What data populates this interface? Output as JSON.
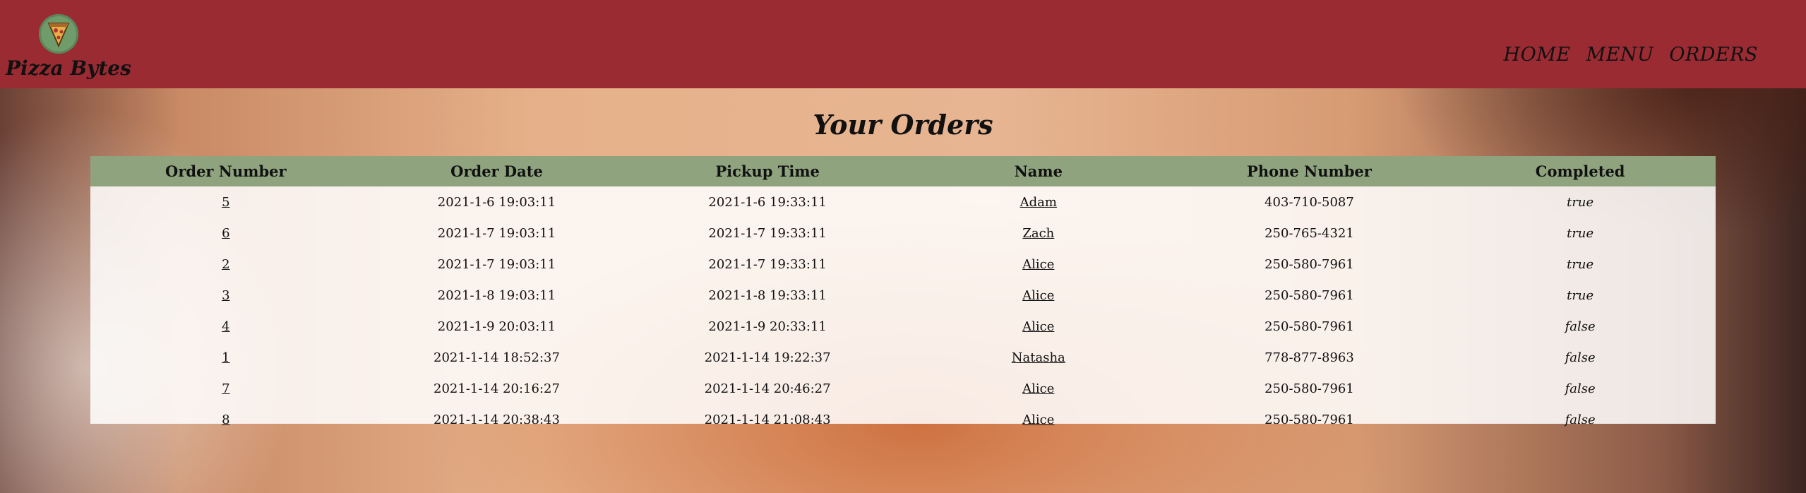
{
  "brand": {
    "name": "Pizza Bytes",
    "logo_icon": "pizza-slice-icon"
  },
  "nav": {
    "items": [
      "HOME",
      "MENU",
      "ORDERS"
    ]
  },
  "page": {
    "title": "Your Orders"
  },
  "table": {
    "headers": [
      "Order Number",
      "Order Date",
      "Pickup Time",
      "Name",
      "Phone Number",
      "Completed"
    ],
    "rows": [
      {
        "order_number": "5",
        "order_date": "2021-1-6 19:03:11",
        "pickup_time": "2021-1-6 19:33:11",
        "name": "Adam",
        "phone": "403-710-5087",
        "completed": "true"
      },
      {
        "order_number": "6",
        "order_date": "2021-1-7 19:03:11",
        "pickup_time": "2021-1-7 19:33:11",
        "name": "Zach",
        "phone": "250-765-4321",
        "completed": "true"
      },
      {
        "order_number": "2",
        "order_date": "2021-1-7 19:03:11",
        "pickup_time": "2021-1-7 19:33:11",
        "name": "Alice",
        "phone": "250-580-7961",
        "completed": "true"
      },
      {
        "order_number": "3",
        "order_date": "2021-1-8 19:03:11",
        "pickup_time": "2021-1-8 19:33:11",
        "name": "Alice",
        "phone": "250-580-7961",
        "completed": "true"
      },
      {
        "order_number": "4",
        "order_date": "2021-1-9 20:03:11",
        "pickup_time": "2021-1-9 20:33:11",
        "name": "Alice",
        "phone": "250-580-7961",
        "completed": "false"
      },
      {
        "order_number": "1",
        "order_date": "2021-1-14 18:52:37",
        "pickup_time": "2021-1-14 19:22:37",
        "name": "Natasha",
        "phone": "778-877-8963",
        "completed": "false"
      },
      {
        "order_number": "7",
        "order_date": "2021-1-14 20:16:27",
        "pickup_time": "2021-1-14 20:46:27",
        "name": "Alice",
        "phone": "250-580-7961",
        "completed": "false"
      },
      {
        "order_number": "8",
        "order_date": "2021-1-14 20:38:43",
        "pickup_time": "2021-1-14 21:08:43",
        "name": "Alice",
        "phone": "250-580-7961",
        "completed": "false"
      }
    ]
  },
  "colors": {
    "header_bg": "#9a2b33",
    "table_header_bg": "#8fa47e",
    "logo_bg": "#6f9c6a"
  }
}
